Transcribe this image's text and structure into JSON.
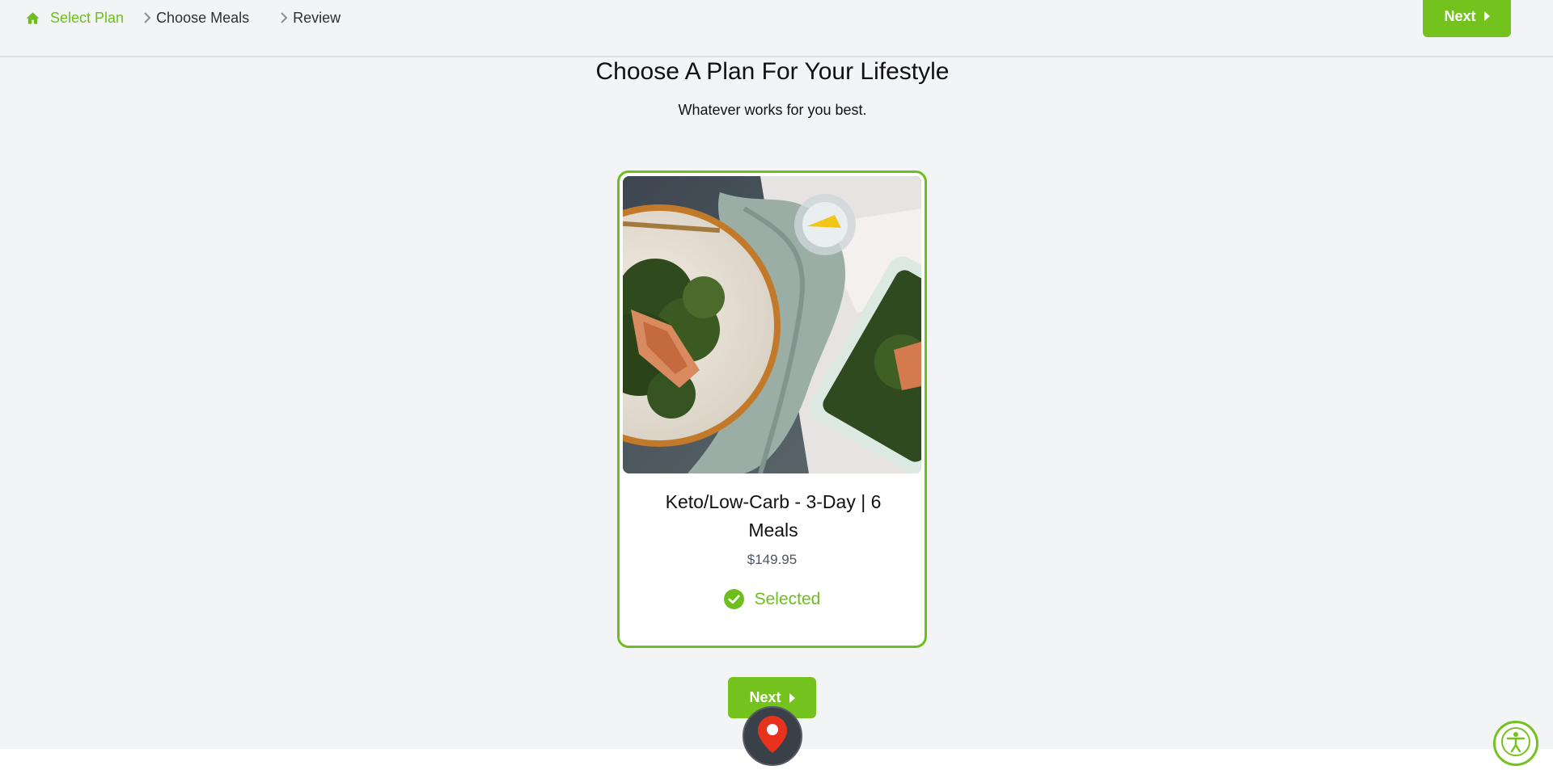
{
  "breadcrumb": {
    "items": [
      {
        "label": "Select Plan",
        "active": true
      },
      {
        "label": "Choose Meals",
        "active": false
      },
      {
        "label": "Review",
        "active": false
      }
    ]
  },
  "header": {
    "next_label": "Next"
  },
  "page": {
    "title": "Choose A Plan For Your Lifestyle",
    "subtitle": "Whatever works for you best."
  },
  "plan_card": {
    "name": "Keto/Low-Carb - 3-Day | 6 Meals",
    "price": "$149.95",
    "status": "Selected"
  },
  "footer": {
    "next_label": "Next"
  },
  "icons": {
    "home": "home-icon",
    "separator": "chevron-right-icon",
    "next": "caret-right-icon",
    "check": "check-circle-icon",
    "map": "map-pin-icon",
    "accessibility": "accessibility-icon"
  },
  "colors": {
    "accent": "#74c21e",
    "background": "#f3f4f6",
    "fab": "#3a4048",
    "pin": "#e8321d"
  }
}
